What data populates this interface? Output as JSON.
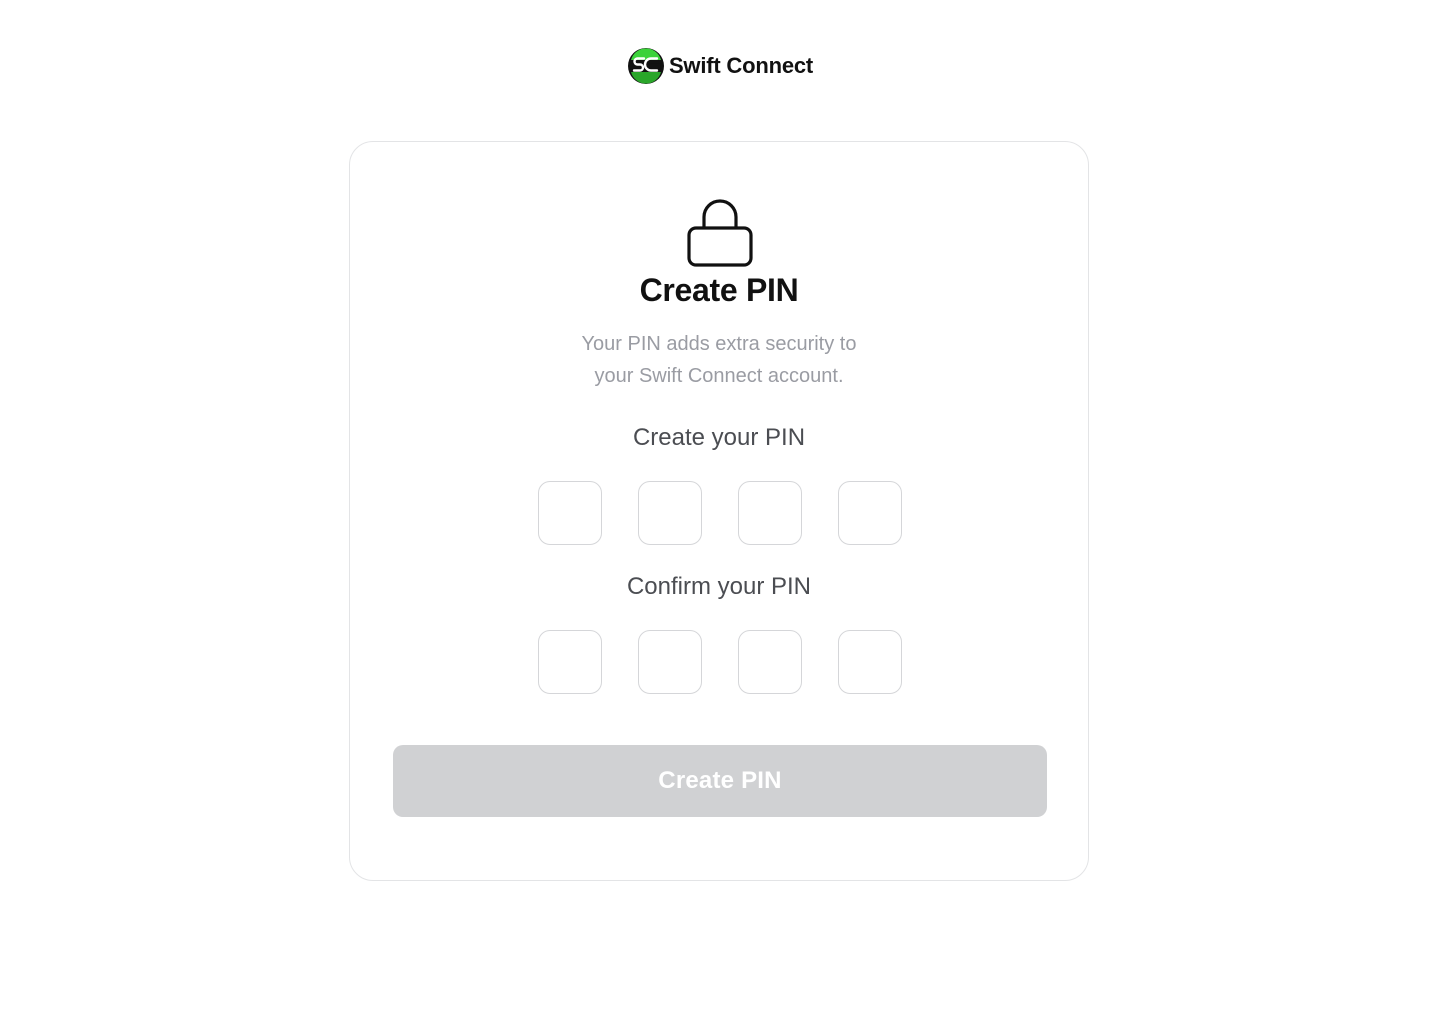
{
  "brand": {
    "name": "Swift Connect",
    "logo_icon": "swift-connect-logo-icon",
    "colors": {
      "green": "#3bd23a",
      "dark": "#111111"
    }
  },
  "card": {
    "icon": "lock-icon",
    "title": "Create PIN",
    "subtitle_line1": "Your PIN adds extra security to",
    "subtitle_line2": "your Swift Connect account.",
    "create_label": "Create your PIN",
    "confirm_label": "Confirm your PIN",
    "create_pin": [
      "",
      "",
      "",
      ""
    ],
    "confirm_pin": [
      "",
      "",
      "",
      ""
    ],
    "submit_label": "Create PIN",
    "submit_disabled": true,
    "submit_color": "#d0d1d3"
  }
}
